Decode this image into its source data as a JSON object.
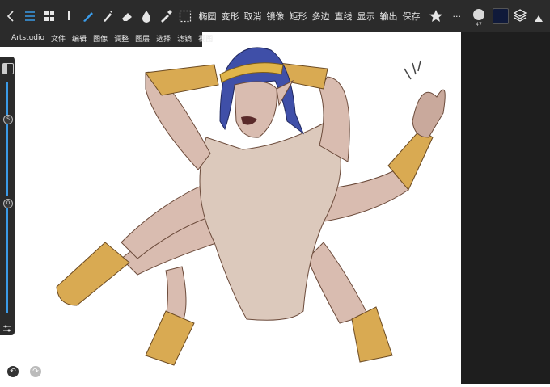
{
  "toolbar": {
    "tools": [
      "back-icon",
      "menu-icon",
      "grid-icon",
      "pencil-tool-icon",
      "brush-tool-icon",
      "smudge-tool-icon",
      "eraser-tool-icon",
      "fill-tool-icon",
      "eyedropper-tool-icon",
      "selection-tool-icon"
    ],
    "commands": [
      "椭圆",
      "变形",
      "取消",
      "镜像",
      "矩形",
      "多边",
      "直线",
      "显示",
      "输出",
      "保存"
    ],
    "star_icon": "star-icon",
    "more_label": "···"
  },
  "menubar": {
    "items": [
      "Artstudio",
      "文件",
      "编辑",
      "图像",
      "调整",
      "图层",
      "选择",
      "滤镜",
      "视图"
    ]
  },
  "rightbar": {
    "brush_size": "47",
    "color": "#101a3a"
  },
  "leftpanel": {
    "size_knob": "S",
    "opacity_knob": "O"
  },
  "colors": {
    "accent": "#3b9be8",
    "toolbar_bg": "#2b2b2b",
    "skin": "#dcc9bc",
    "gold": "#d9aa52",
    "hair": "#3f4fa8"
  }
}
